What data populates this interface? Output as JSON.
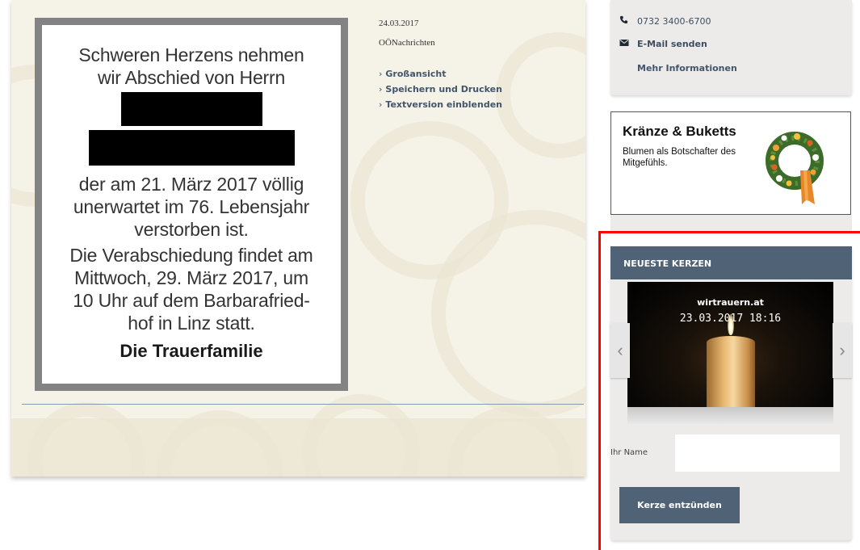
{
  "obituary": {
    "lines_top": [
      "Schweren Herzens nehmen",
      "wir Abschied von Herrn"
    ],
    "lines_middle": [
      "der am 21. März 2017 völlig",
      "unerwartet im 76. Lebensjahr",
      "verstorben ist."
    ],
    "lines_bottom": [
      "Die Verabschiedung findet am",
      "Mittwoch, 29. März 2017, um",
      "10 Uhr auf dem Barbarafried-",
      "hof in Linz statt."
    ],
    "signature": "Die Trauerfamilie"
  },
  "meta": {
    "date": "24.03.2017",
    "source": "OÖNachrichten",
    "links": [
      "Großansicht",
      "Speichern und Drucken",
      "Textversion einblenden"
    ]
  },
  "contact": {
    "phone": "0732 3400-6700",
    "email_label": "E-Mail senden",
    "more_label": "Mehr Informationen"
  },
  "ad": {
    "title": "Kränze & Buketts",
    "text": "Blumen als Botschafter des Mitgefühls."
  },
  "candles": {
    "header": "NEUESTE KERZEN",
    "image_site": "wirtrauern.at",
    "image_timestamp": "23.03.2017 18:16",
    "name_label": "Ihr Name",
    "name_value": "",
    "button_label": "Kerze entzünden"
  },
  "colors": {
    "accent": "#506275",
    "link": "#41556b",
    "highlight": "#ff0000"
  }
}
